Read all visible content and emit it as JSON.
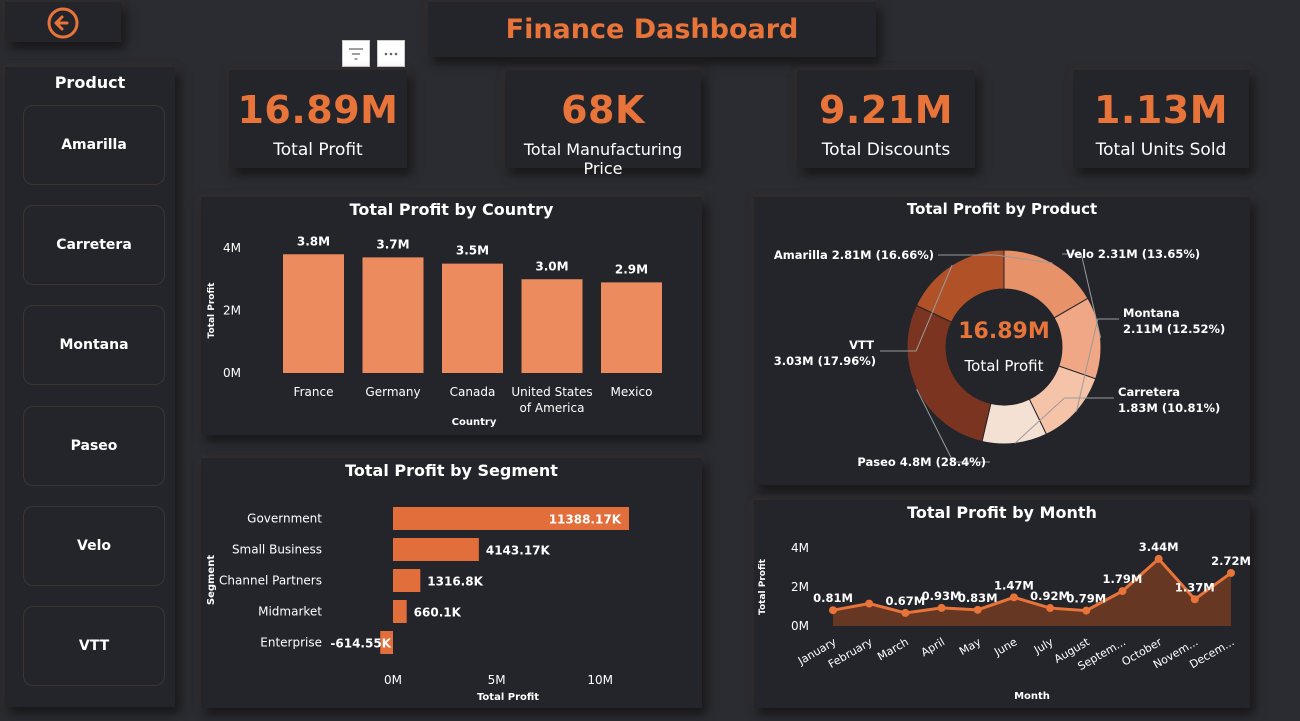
{
  "header": {
    "title": "Finance Dashboard",
    "back_icon": "arrow-left-circle-icon"
  },
  "toolbar": {
    "filter_icon": "filter-icon",
    "more_icon": "more-options-icon"
  },
  "slicer": {
    "title": "Product",
    "items": [
      {
        "label": "Amarilla"
      },
      {
        "label": "Carretera"
      },
      {
        "label": "Montana"
      },
      {
        "label": "Paseo"
      },
      {
        "label": "Velo"
      },
      {
        "label": "VTT"
      }
    ]
  },
  "kpis": [
    {
      "value": "16.89M",
      "label": "Total Profit"
    },
    {
      "value": "68K",
      "label": "Total Manufacturing Price"
    },
    {
      "value": "9.21M",
      "label": "Total Discounts"
    },
    {
      "value": "1.13M",
      "label": "Total Units Sold"
    }
  ],
  "colors": {
    "accent": "#e8743a",
    "bar": "#eb8b5e",
    "segment_bar": "#e26f3b",
    "card_bg": "#23252b",
    "page_bg": "#2b2c31",
    "donut": [
      "#e8926a",
      "#f0a785",
      "#f5c4a8",
      "#f5e0d4",
      "#7a3420",
      "#b15128"
    ]
  },
  "chart_data": [
    {
      "id": "country",
      "type": "bar",
      "title": "Total Profit by Country",
      "xlabel": "Country",
      "ylabel": "Total Profit",
      "categories": [
        "France",
        "Germany",
        "Canada",
        "United States of America",
        "Mexico"
      ],
      "category_lines": [
        [
          "France"
        ],
        [
          "Germany"
        ],
        [
          "Canada"
        ],
        [
          "United States",
          "of America"
        ],
        [
          "Mexico"
        ]
      ],
      "values": [
        3.8,
        3.7,
        3.5,
        3.0,
        2.9
      ],
      "data_labels": [
        "3.8M",
        "3.7M",
        "3.5M",
        "3.0M",
        "2.9M"
      ],
      "yticks": [
        "0M",
        "2M",
        "4M"
      ],
      "ytick_values": [
        0,
        2,
        4
      ],
      "ylim": [
        0,
        4
      ]
    },
    {
      "id": "segment",
      "type": "bar",
      "orientation": "horizontal",
      "title": "Total Profit by Segment",
      "xlabel": "Total Profit",
      "ylabel": "Segment",
      "categories": [
        "Government",
        "Small Business",
        "Channel Partners",
        "Midmarket",
        "Enterprise"
      ],
      "values": [
        11388.17,
        4143.17,
        1316.8,
        660.1,
        -614.55
      ],
      "data_labels": [
        "11388.17K",
        "4143.17K",
        "1316.8K",
        "660.1K",
        "-614.55K"
      ],
      "xticks": [
        "0M",
        "5M",
        "10M"
      ],
      "xtick_values": [
        0,
        5000,
        10000
      ],
      "xlim": [
        0,
        11388.17
      ]
    },
    {
      "id": "product",
      "type": "pie",
      "style": "donut",
      "title": "Total Profit by Product",
      "center_value": "16.89M",
      "center_label": "Total Profit",
      "categories": [
        "Amarilla",
        "Velo",
        "Montana",
        "Carretera",
        "Paseo",
        "VTT"
      ],
      "values": [
        2.81,
        2.31,
        2.11,
        1.83,
        4.8,
        3.03
      ],
      "percents": [
        16.66,
        13.65,
        12.52,
        10.81,
        28.4,
        17.96
      ],
      "labels": [
        {
          "name": "Amarilla",
          "text": "2.81M (16.66%)"
        },
        {
          "name": "Velo",
          "text": "2.31M (13.65%)"
        },
        {
          "name": "Montana",
          "text": "2.11M (12.52%)"
        },
        {
          "name": "Carretera",
          "text": "1.83M (10.81%)"
        },
        {
          "name": "Paseo",
          "text": "4.8M (28.4%)"
        },
        {
          "name": "VTT",
          "text": "3.03M (17.96%)"
        }
      ]
    },
    {
      "id": "month",
      "type": "area",
      "title": "Total Profit by Month",
      "xlabel": "Month",
      "ylabel": "Total Profit",
      "categories": [
        "January",
        "February",
        "March",
        "April",
        "May",
        "June",
        "July",
        "August",
        "Septem...",
        "October",
        "Novem...",
        "Decem..."
      ],
      "values": [
        0.81,
        1.15,
        0.67,
        0.93,
        0.83,
        1.47,
        0.92,
        0.79,
        1.79,
        3.44,
        1.37,
        2.72
      ],
      "data_labels": [
        "0.81M",
        "",
        "0.67M",
        "0.93M",
        "0.83M",
        "1.47M",
        "0.92M",
        "0.79M",
        "1.79M",
        "3.44M",
        "1.37M",
        "2.72M"
      ],
      "yticks": [
        "0M",
        "2M",
        "4M"
      ],
      "ytick_values": [
        0,
        2,
        4
      ],
      "ylim": [
        0,
        4
      ]
    }
  ]
}
